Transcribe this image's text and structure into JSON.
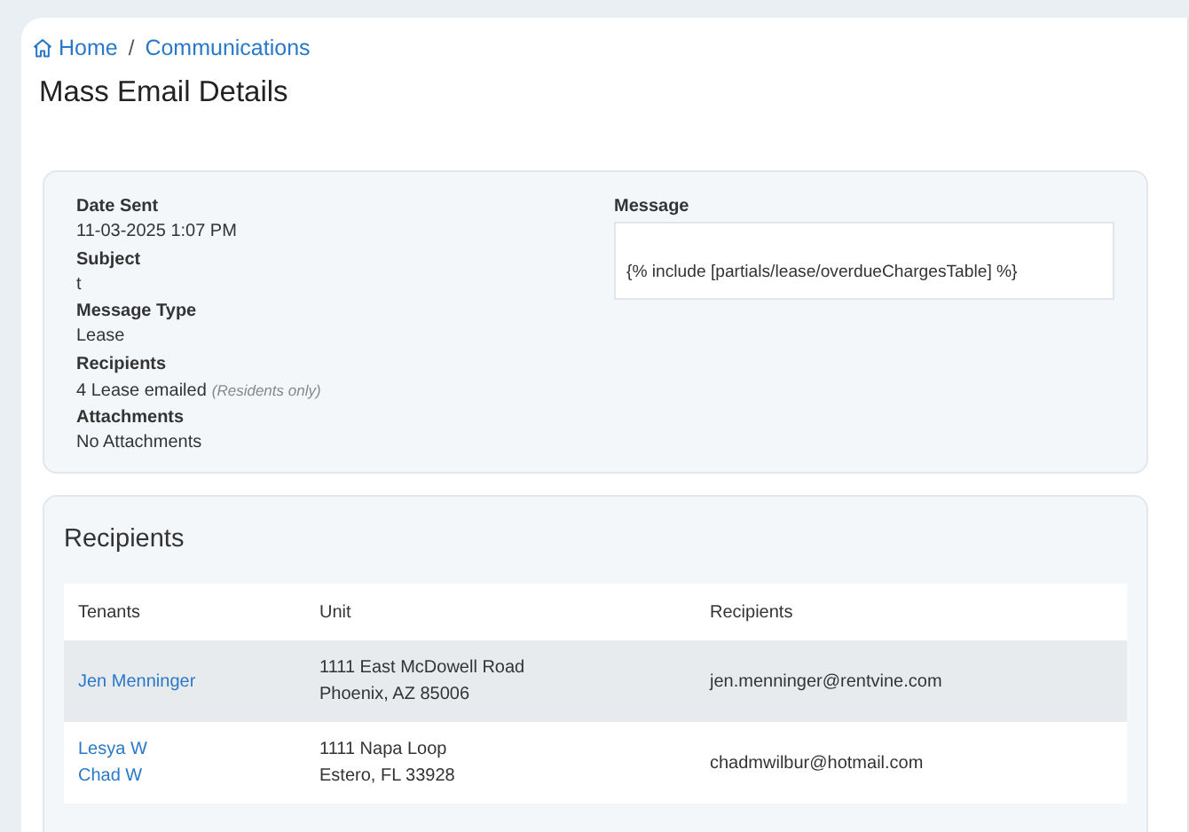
{
  "breadcrumb": [
    {
      "label": "Home",
      "kind": "home"
    },
    {
      "label": "Communications",
      "kind": "link"
    }
  ],
  "breadcrumb_separator": "/",
  "page_title": "Mass Email Details",
  "details": [
    {
      "label": "Date Sent",
      "value": "11-03-2025 1:07 PM"
    },
    {
      "label": "Subject",
      "value": "t"
    },
    {
      "label": "Message Type",
      "value": "Lease"
    },
    {
      "label": "Recipients",
      "value": "4 Lease emailed",
      "note": "(Residents only)"
    },
    {
      "label": "Attachments",
      "value": "No Attachments"
    }
  ],
  "message": {
    "label": "Message",
    "body": "{% include [partials/lease/overdueChargesTable] %}"
  },
  "recipients": {
    "title": "Recipients",
    "columns": [
      "Tenants",
      "Unit",
      "Recipients"
    ],
    "rows": [
      {
        "tenants": [
          "Jen Menninger"
        ],
        "unit": [
          "1111 East McDowell Road",
          "Phoenix, AZ 85006"
        ],
        "email": "jen.menninger@rentvine.com"
      },
      {
        "tenants": [
          "Lesya W",
          "Chad W"
        ],
        "unit": [
          "1111 Napa Loop",
          "Estero, FL 33928"
        ],
        "email": "chadmwilbur@hotmail.com"
      }
    ]
  }
}
